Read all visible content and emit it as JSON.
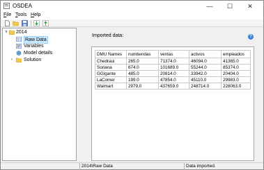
{
  "window": {
    "title": "OSDEA"
  },
  "menu": {
    "items": [
      {
        "mnemonic": "F",
        "rest": "ile"
      },
      {
        "mnemonic": "T",
        "rest": "ools"
      },
      {
        "mnemonic": "H",
        "rest": "elp"
      }
    ]
  },
  "tree": {
    "root": "2014",
    "children": [
      "Raw Data",
      "Variables",
      "Model details",
      "Solution"
    ]
  },
  "main": {
    "section_title": "Imported data:",
    "table": {
      "headers": [
        "DMU Names",
        "numtiendas",
        "ventas",
        "activos",
        "empleados"
      ],
      "rows": [
        [
          "Chedraui",
          "265.0",
          "71374.0",
          "46094.0",
          "41365.0"
        ],
        [
          "Soriana",
          "674.0",
          "101689.0",
          "55244.0",
          "85374.0"
        ],
        [
          "GGigante",
          "485.0",
          "20814.0",
          "33942.0",
          "20404.0"
        ],
        [
          "LaComer",
          "199.0",
          "47854.0",
          "45110.0",
          "29983.0"
        ],
        [
          "Walmart",
          "2979.0",
          "437659.0",
          "248714.0",
          "228063.0"
        ]
      ]
    }
  },
  "status": {
    "left": "",
    "middle": "2014\\Raw Data",
    "right": "Data imported."
  },
  "colors": {
    "selection": "#cce8ff",
    "accent": "#3b82d6"
  }
}
